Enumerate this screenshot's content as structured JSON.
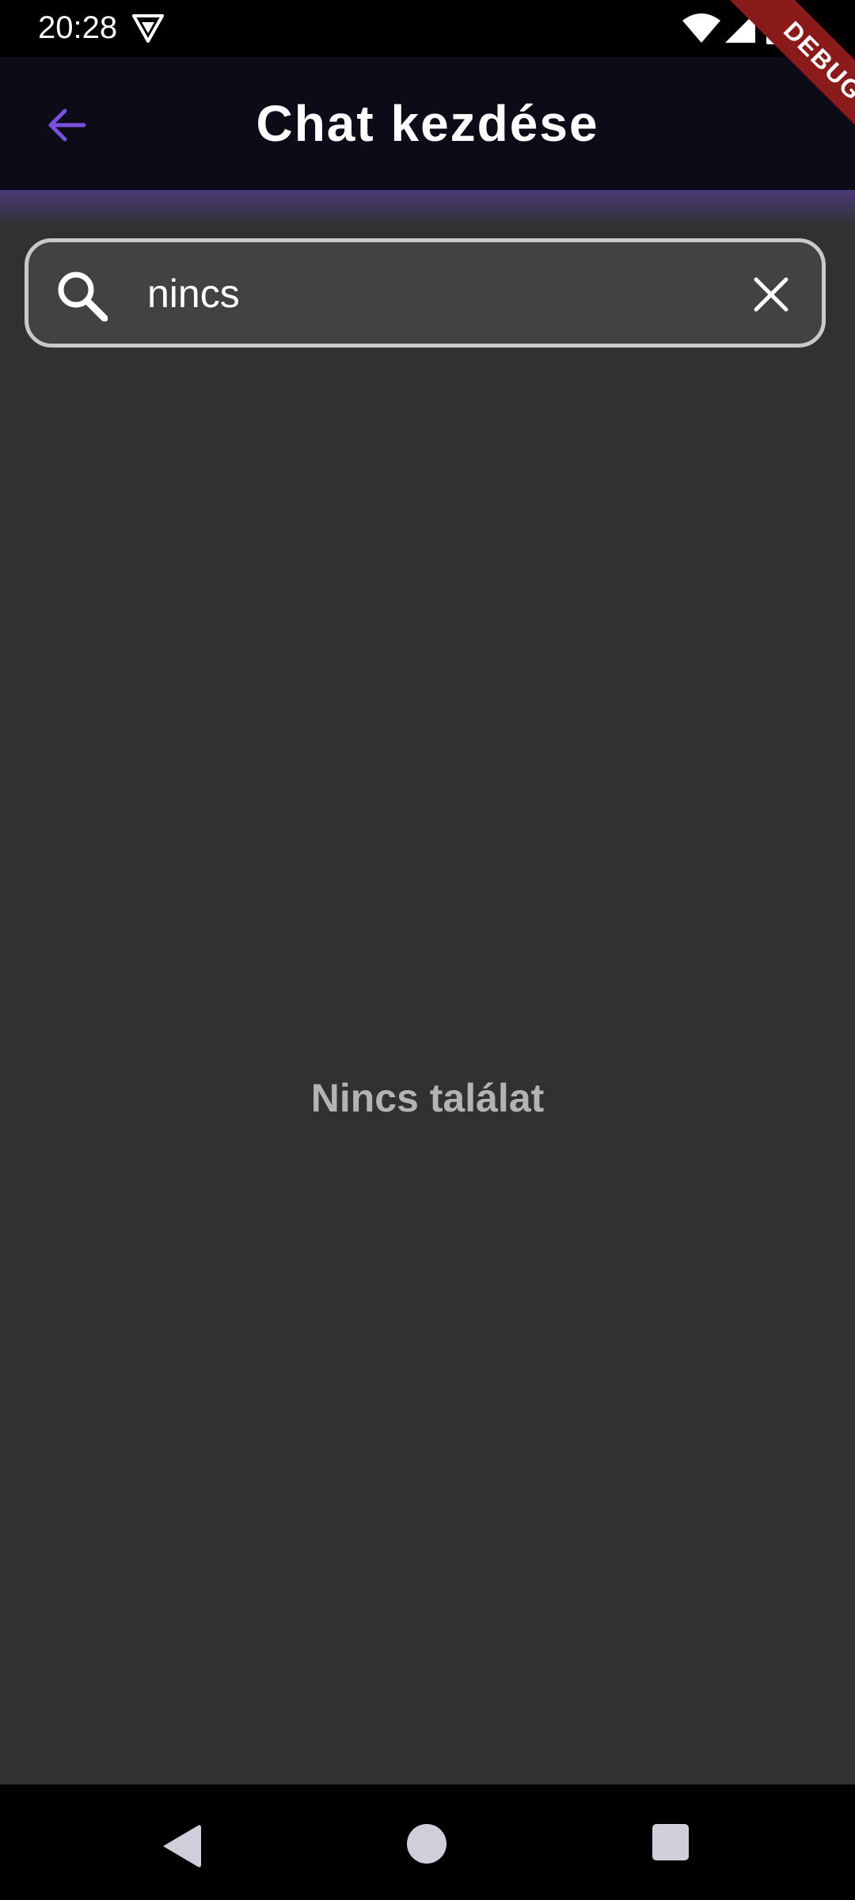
{
  "status_bar": {
    "time": "20:28",
    "icons": [
      "vpn-icon",
      "wifi-icon",
      "signal-icon",
      "battery-icon"
    ]
  },
  "app_bar": {
    "title": "Chat kezdése",
    "back_icon": "arrow-left-icon",
    "accent_color": "#7b4fe0"
  },
  "search": {
    "value": "nincs",
    "placeholder": "",
    "search_icon": "search-icon",
    "clear_icon": "close-icon"
  },
  "results": {
    "empty_message": "Nincs találat"
  },
  "debug_banner": {
    "label": "DEBUG"
  },
  "nav_bar": {
    "icons": [
      "back-triangle-icon",
      "home-circle-icon",
      "recents-square-icon"
    ]
  },
  "colors": {
    "background": "#313131",
    "app_bar": "#0d0b17",
    "search_field": "#424242",
    "search_border": "#c9c9c9",
    "debug_ribbon": "#8b1a1a"
  }
}
